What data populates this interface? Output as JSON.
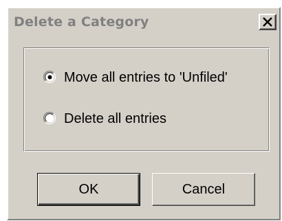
{
  "window": {
    "title": "Delete a Category",
    "close_glyph": "X"
  },
  "options": [
    {
      "label": "Move all entries to 'Unfiled'",
      "selected": true
    },
    {
      "label": "Delete all entries",
      "selected": false
    }
  ],
  "buttons": {
    "ok_label": "OK",
    "cancel_label": "Cancel"
  },
  "colors": {
    "dialog_face": "#d4d0c8",
    "title_text_inactive": "#808080"
  },
  "icons": {
    "close": "close-icon",
    "radio_selected": "radio-selected-icon",
    "radio_unselected": "radio-unselected-icon"
  }
}
